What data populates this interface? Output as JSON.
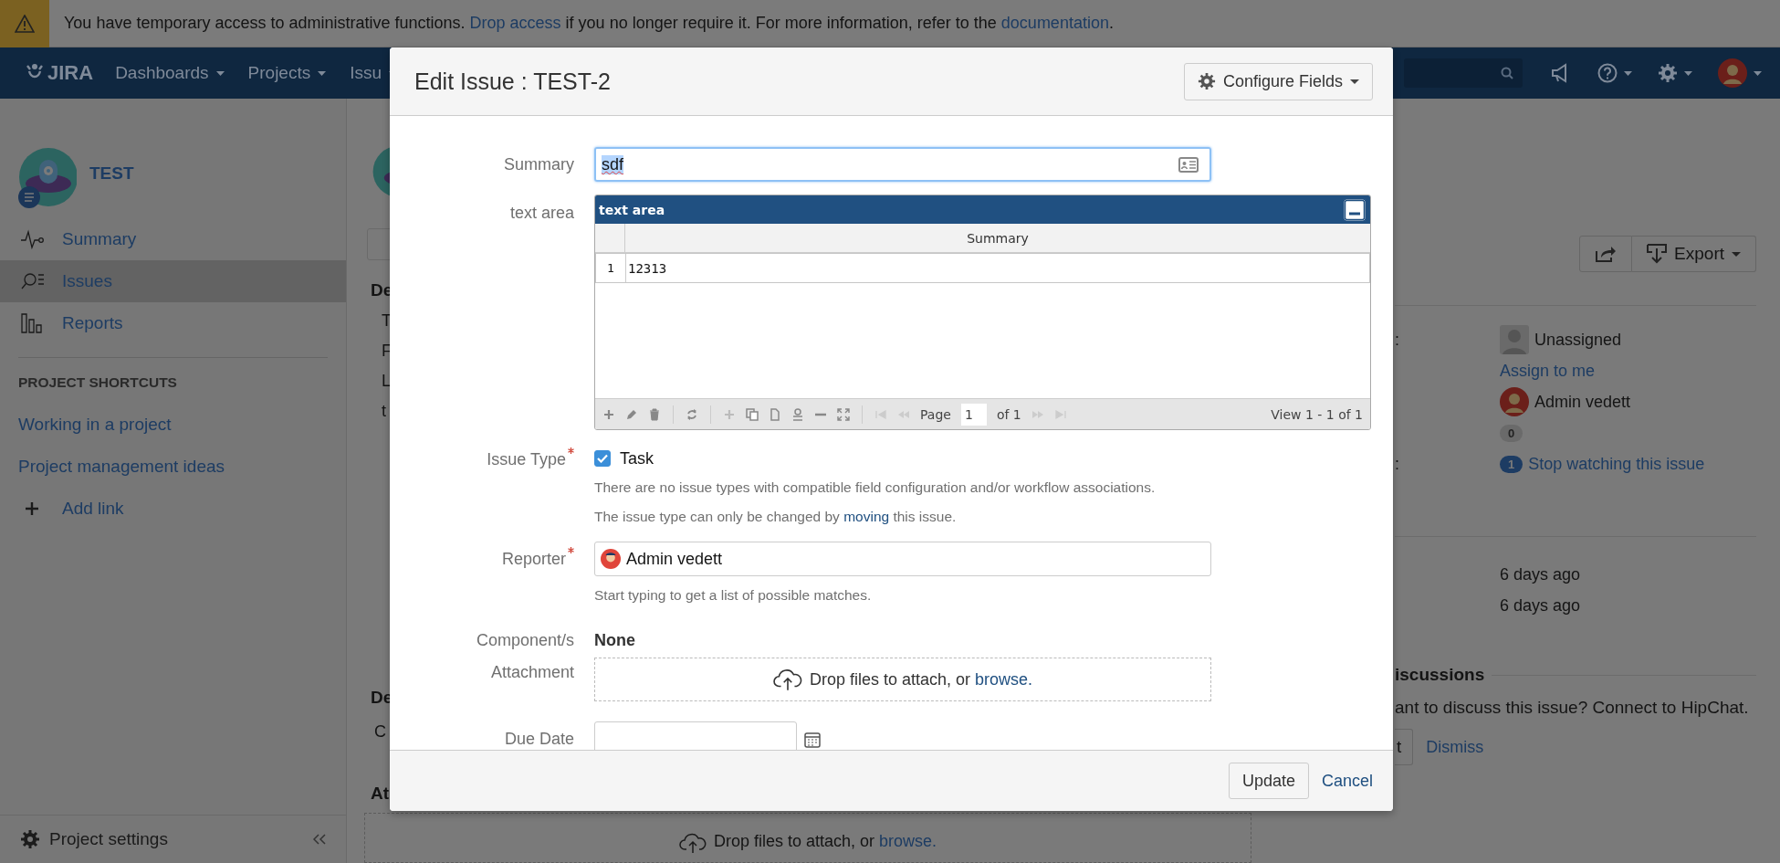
{
  "banner": {
    "parts": [
      {
        "kind": "text",
        "text": "You have temporary access to administrative functions. "
      },
      {
        "kind": "link",
        "text": "Drop access"
      },
      {
        "kind": "text",
        "text": " if you no longer require it. For more information, refer to the "
      },
      {
        "kind": "link",
        "text": "documentation"
      },
      {
        "kind": "text",
        "text": "."
      }
    ]
  },
  "nav": {
    "logo": "JIRA",
    "items": [
      "Dashboards",
      "Projects",
      "Issu"
    ]
  },
  "sidebar": {
    "project": "TEST",
    "items": [
      {
        "label": "Summary",
        "selected": false
      },
      {
        "label": "Issues",
        "selected": true
      },
      {
        "label": "Reports",
        "selected": false
      }
    ],
    "shortcuts_heading": "PROJECT SHORTCUTS",
    "shortcuts": [
      "Working in a project",
      "Project management ideas"
    ],
    "add_link": "Add link",
    "settings": "Project settings"
  },
  "issue_view": {
    "description_heading": "De",
    "description_lines": [
      "T",
      "F",
      "L",
      "t"
    ],
    "dates_heading": "De",
    "dates_line": "C",
    "attachments_heading": "At",
    "dropzone": {
      "text": "Drop files to attach, or ",
      "link": "browse."
    },
    "export_button": "Export",
    "people_label": ":",
    "assignee": "Unassigned",
    "assign_link": "Assign to me",
    "reporter": "Admin vedett",
    "votes": "0",
    "watchers_label": ":",
    "watchers": "1",
    "watch_link": "Stop watching this issue",
    "created": "6 days ago",
    "updated": "6 days ago",
    "hipchat": {
      "heading": "iscussions",
      "text": "ant to discuss this issue? Connect to HipChat.",
      "connect_button": "t",
      "dismiss": "Dismiss"
    }
  },
  "modal": {
    "title": "Edit Issue : TEST-2",
    "configure_button": "Configure Fields",
    "fields": [
      {
        "kind": "text",
        "label": "Summary",
        "required": false,
        "value": "sdf"
      },
      {
        "kind": "grid",
        "label": "text area",
        "required": false,
        "title": "text area",
        "column": "Summary",
        "rows": [
          {
            "number": "1",
            "value": "12313"
          }
        ],
        "page_label": "Page",
        "page": "1",
        "page_total": "of 1",
        "view": "View 1 - 1 of 1"
      },
      {
        "kind": "checkbox",
        "label": "Issue Type",
        "required": true,
        "option": "Task",
        "checked": true,
        "notes": [
          {
            "text": "There are no issue types with compatible field configuration and/or workflow associations."
          },
          {
            "text": "The issue type can only be changed by ",
            "link": "moving",
            "after": " this issue."
          }
        ]
      },
      {
        "kind": "user",
        "label": "Reporter",
        "required": true,
        "value": "Admin vedett",
        "hint": "Start typing to get a list of possible matches."
      },
      {
        "kind": "static",
        "label": "Component/s",
        "required": false,
        "value": "None"
      },
      {
        "kind": "dropzone",
        "label": "Attachment",
        "required": false,
        "text": "Drop files to attach, or ",
        "link": "browse."
      },
      {
        "kind": "date",
        "label": "Due Date",
        "required": false
      }
    ],
    "submit": "Update",
    "cancel": "Cancel"
  }
}
